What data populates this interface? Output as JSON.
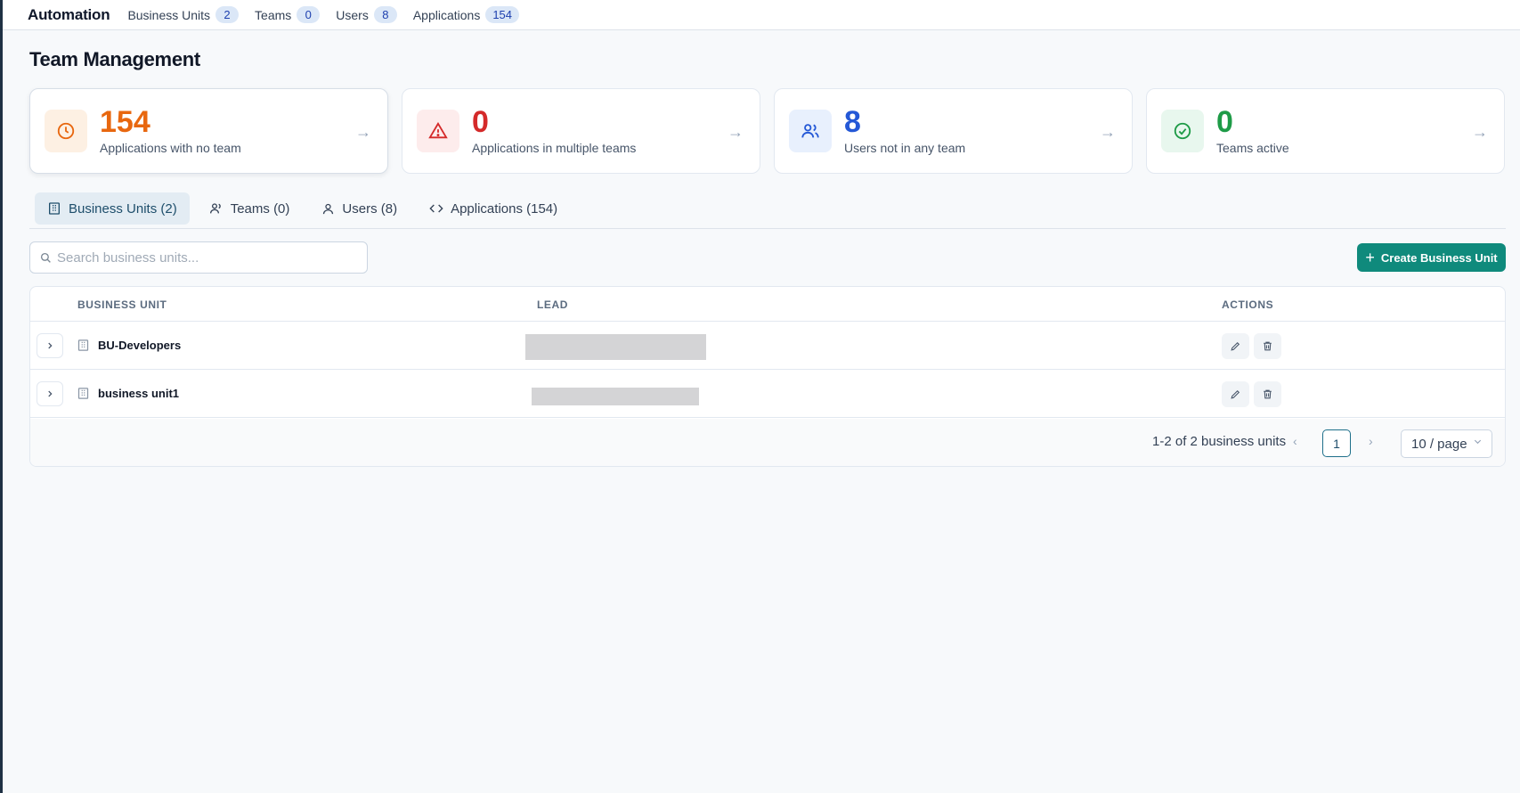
{
  "topbar": {
    "brand": "Automation",
    "items": [
      {
        "label": "Business Units",
        "count": "2"
      },
      {
        "label": "Teams",
        "count": "0"
      },
      {
        "label": "Users",
        "count": "8"
      },
      {
        "label": "Applications",
        "count": "154"
      }
    ]
  },
  "page": {
    "title": "Team Management"
  },
  "cards": [
    {
      "value": "154",
      "label": "Applications with no team",
      "color": "#e8670f",
      "bg": "#fdf0e3",
      "icon": "clock-icon"
    },
    {
      "value": "0",
      "label": "Applications in multiple teams",
      "color": "#d42a2a",
      "bg": "#fdecec",
      "icon": "warning-icon"
    },
    {
      "value": "8",
      "label": "Users not in any team",
      "color": "#2458d6",
      "bg": "#e8f0fd",
      "icon": "users-icon"
    },
    {
      "value": "0",
      "label": "Teams active",
      "color": "#1e9b47",
      "bg": "#e8f7ee",
      "icon": "check-circle-icon"
    }
  ],
  "tabs": [
    {
      "label": "Business Units (2)",
      "icon": "building-icon",
      "active": true
    },
    {
      "label": "Teams (0)",
      "icon": "users-icon"
    },
    {
      "label": "Users (8)",
      "icon": "user-icon"
    },
    {
      "label": "Applications (154)",
      "icon": "code-icon"
    }
  ],
  "search": {
    "placeholder": "Search business units..."
  },
  "create_button": {
    "label": "Create Business Unit"
  },
  "table": {
    "columns": {
      "business_unit": "BUSINESS UNIT",
      "lead": "LEAD",
      "actions": "ACTIONS"
    },
    "rows": [
      {
        "name": "BU-Developers"
      },
      {
        "name": "business unit1"
      }
    ]
  },
  "pagination": {
    "range": "1-2 of 2 business units",
    "page": "1",
    "per_page": "10 / page"
  }
}
